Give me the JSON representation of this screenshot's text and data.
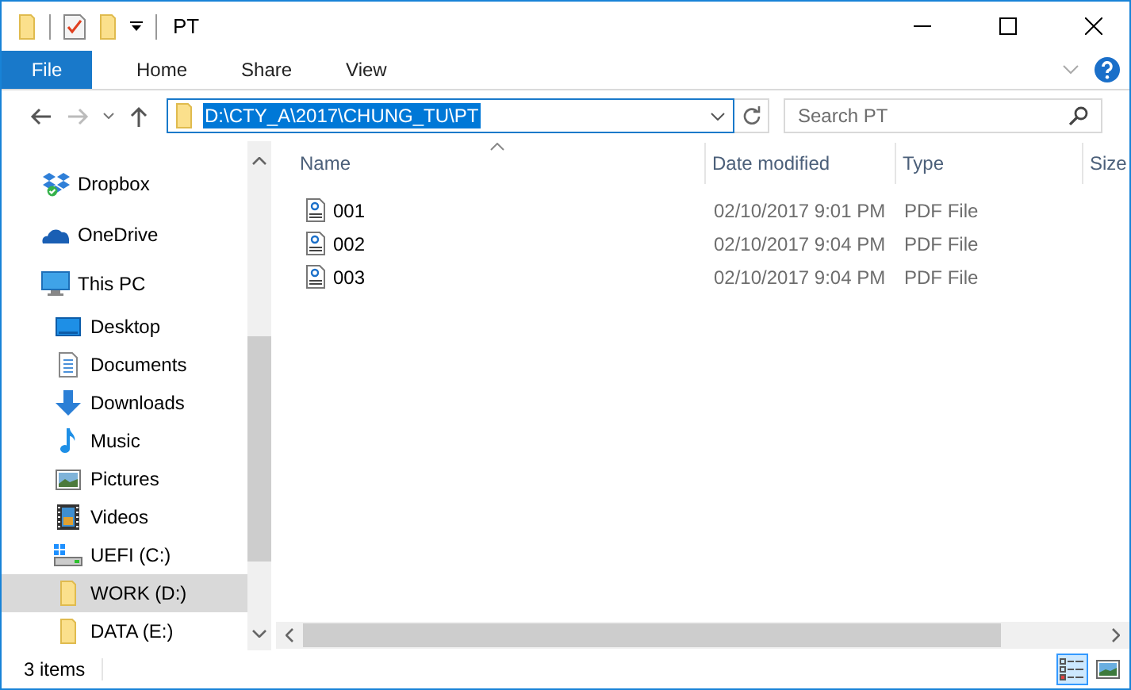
{
  "window": {
    "title": "PT"
  },
  "ribbon": {
    "tabs": [
      {
        "label": "File",
        "kind": "menu",
        "selected": false
      },
      {
        "label": "Home",
        "kind": "tab",
        "selected": false
      },
      {
        "label": "Share",
        "kind": "tab",
        "selected": false
      },
      {
        "label": "View",
        "kind": "tab",
        "selected": false
      }
    ]
  },
  "address_bar": {
    "value": "D:\\CTY_A\\2017\\CHUNG_TU\\PT",
    "text_selected": true
  },
  "search": {
    "placeholder": "Search PT"
  },
  "sidebar": {
    "items": [
      {
        "label": "Dropbox",
        "kind": "dropbox",
        "selected": false
      },
      {
        "label": "OneDrive",
        "kind": "cloud",
        "selected": false
      },
      {
        "label": "This PC",
        "kind": "pc",
        "selected": false,
        "children": [
          {
            "label": "Desktop",
            "kind": "desktop",
            "selected": false
          },
          {
            "label": "Documents",
            "kind": "documents",
            "selected": false
          },
          {
            "label": "Downloads",
            "kind": "downloads",
            "selected": false
          },
          {
            "label": "Music",
            "kind": "music",
            "selected": false
          },
          {
            "label": "Pictures",
            "kind": "pictures",
            "selected": false
          },
          {
            "label": "Videos",
            "kind": "videos",
            "selected": false
          },
          {
            "label": "UEFI (C:)",
            "kind": "drive",
            "selected": false
          },
          {
            "label": "WORK (D:)",
            "kind": "folder",
            "selected": true
          },
          {
            "label": "DATA (E:)",
            "kind": "folder",
            "selected": false
          }
        ]
      }
    ]
  },
  "table": {
    "columns": [
      "Name",
      "Date modified",
      "Type",
      "Size"
    ],
    "rows": [
      {
        "name": "001",
        "date_modified": "02/10/2017 9:01 PM",
        "type": "PDF File"
      },
      {
        "name": "002",
        "date_modified": "02/10/2017 9:04 PM",
        "type": "PDF File"
      },
      {
        "name": "003",
        "date_modified": "02/10/2017 9:04 PM",
        "type": "PDF File"
      }
    ]
  },
  "status_bar": {
    "text": "3 items",
    "view_buttons": [
      {
        "kind": "details",
        "selected": true
      },
      {
        "kind": "thumbnails",
        "selected": false
      }
    ]
  }
}
